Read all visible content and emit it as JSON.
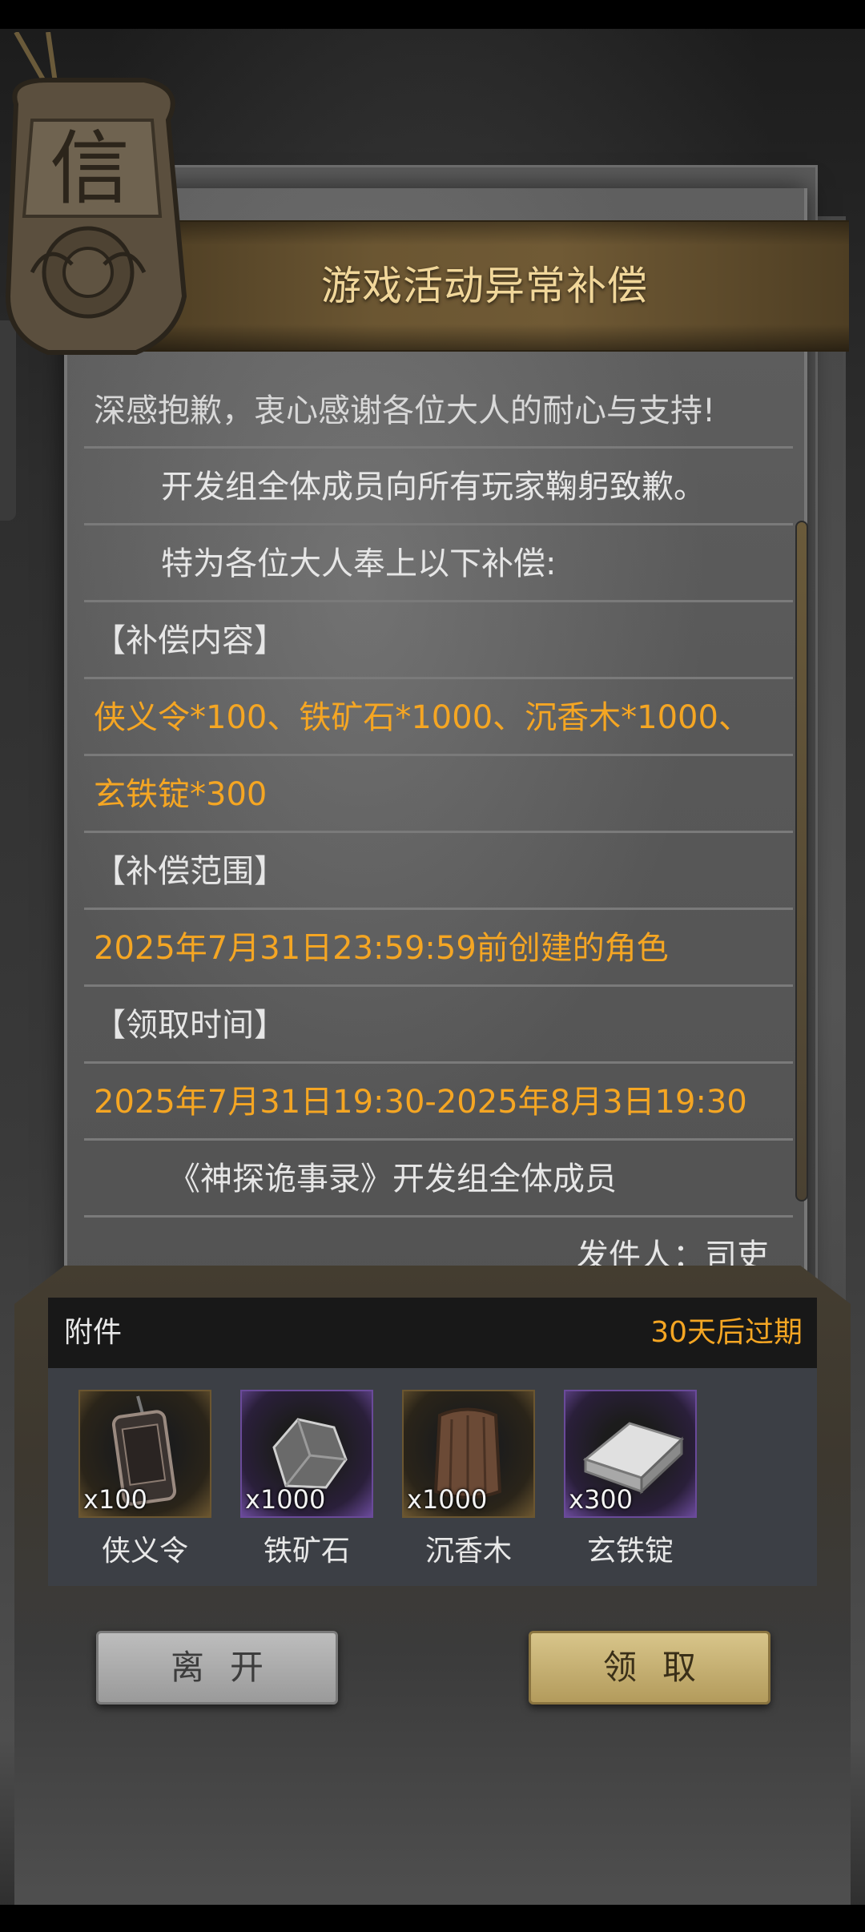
{
  "banner": {
    "title": "游戏活动异常补偿"
  },
  "emblem": {
    "character": "信"
  },
  "letter": {
    "lines": [
      "深感抱歉，衷心感谢各位大人的耐心与支持!",
      "开发组全体成员向所有玩家鞠躬致歉。",
      "特为各位大人奉上以下补偿:",
      "【补偿内容】",
      "侠义令*100、铁矿石*1000、沉香木*1000、",
      "玄铁锭*300",
      "【补偿范围】",
      "2025年7月31日23:59:59前创建的角色",
      "【领取时间】",
      "2025年7月31日19:30-2025年8月3日19:30",
      "《神探诡事录》开发组全体成员",
      "发件人：司吏"
    ]
  },
  "attachments": {
    "label": "附件",
    "expiry": "30天后过期",
    "items": [
      {
        "name": "侠义令",
        "count": "x100",
        "rarity": "gold",
        "icon": "token-plaque-icon"
      },
      {
        "name": "铁矿石",
        "count": "x1000",
        "rarity": "purple",
        "icon": "iron-ore-icon"
      },
      {
        "name": "沉香木",
        "count": "x1000",
        "rarity": "gold",
        "icon": "agarwood-log-icon"
      },
      {
        "name": "玄铁锭",
        "count": "x300",
        "rarity": "purple",
        "icon": "iron-ingot-icon"
      }
    ]
  },
  "buttons": {
    "leave": "离开",
    "claim": "领取"
  },
  "colors": {
    "highlight": "#f5a623",
    "title": "#f1d79a",
    "body_text": "#e6e6e6"
  }
}
